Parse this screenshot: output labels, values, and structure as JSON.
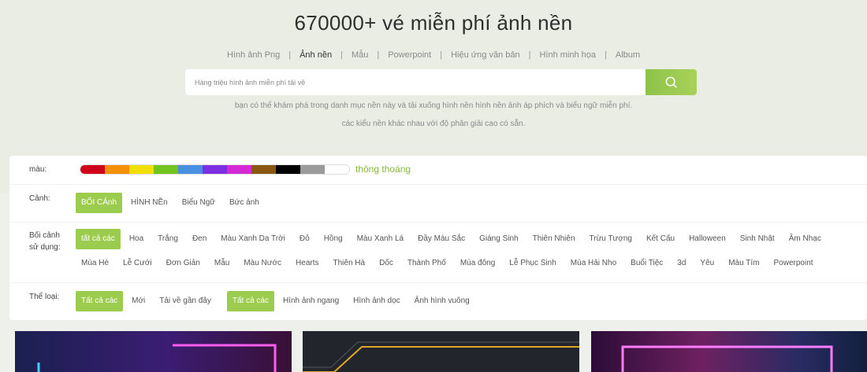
{
  "hero": {
    "title": "670000+ vé miễn phí ảnh nền",
    "tabs": [
      {
        "label": "Hình ảnh Png"
      },
      {
        "label": "Ảnh nền"
      },
      {
        "label": "Mẫu"
      },
      {
        "label": "Powerpoint"
      },
      {
        "label": "Hiệu ứng văn bản"
      },
      {
        "label": "Hình minh họa"
      },
      {
        "label": "Album"
      }
    ],
    "active_tab": "Ảnh nền",
    "search": {
      "placeholder": "Hàng triệu hình ảnh miễn phí tải về",
      "button_icon": "search-icon"
    },
    "description_line1": "bạn có thể khám phá trong danh mục nền này và tải xuống hình nền hình nền ảnh áp phích và biểu ngữ miễn phí.",
    "description_line2": "các kiểu nền khác nhau với độ phân giải cao có sẵn."
  },
  "filters": {
    "color": {
      "label": "màu:",
      "swatches": [
        "#d0021b",
        "#f5900a",
        "#f2de09",
        "#72c41e",
        "#4a90e2",
        "#7b2fe0",
        "#d629d6",
        "#8b5611",
        "#000000",
        "#9b9b9b",
        "#ffffff"
      ],
      "clear_label": "thông thoáng"
    },
    "scene": {
      "label": "Cảnh:",
      "options": [
        "BỐI CẢnh",
        "HÌNH NỀn",
        "Biểu Ngữ",
        "Bức ảnh"
      ],
      "selected": "BỐI CẢnh"
    },
    "usage": {
      "label_line1": "Bối cảnh",
      "label_line2": "sử dụng:",
      "row1": [
        "tất cả các",
        "Hoa",
        "Trắng",
        "Đen",
        "Màu Xanh Da Trời",
        "Đỏ",
        "Hồng",
        "Màu Xanh Lá",
        "Đầy Màu Sắc",
        "Giáng Sinh",
        "Thiên Nhiên",
        "Trừu Tượng",
        "Kết Cấu",
        "Halloween",
        "Sinh Nhật",
        "Âm Nhạc"
      ],
      "row2": [
        "Mùa Hè",
        "Lễ Cưới",
        "Đơn Giản",
        "Mẫu",
        "Màu Nước",
        "Hearts",
        "Thiên Hà",
        "Dốc",
        "Thành Phố",
        "Mùa đông",
        "Lễ Phục Sinh",
        "Mùa Hải Nho",
        "Buổi Tiệc",
        "3d",
        "Yêu",
        "Màu Tím",
        "Powerpoint"
      ],
      "selected": "tất cả các"
    },
    "category": {
      "label": "Thể loại:",
      "options_a": [
        "Tất cả các",
        "Mới",
        "Tải về gần đây"
      ],
      "options_b": [
        "Tất cả các",
        "Hình ảnh ngang",
        "Hình ảnh dọc",
        "Ảnh hình vuông"
      ],
      "selected_a": "Tất cả các",
      "selected_b": "Tất cả các"
    }
  }
}
